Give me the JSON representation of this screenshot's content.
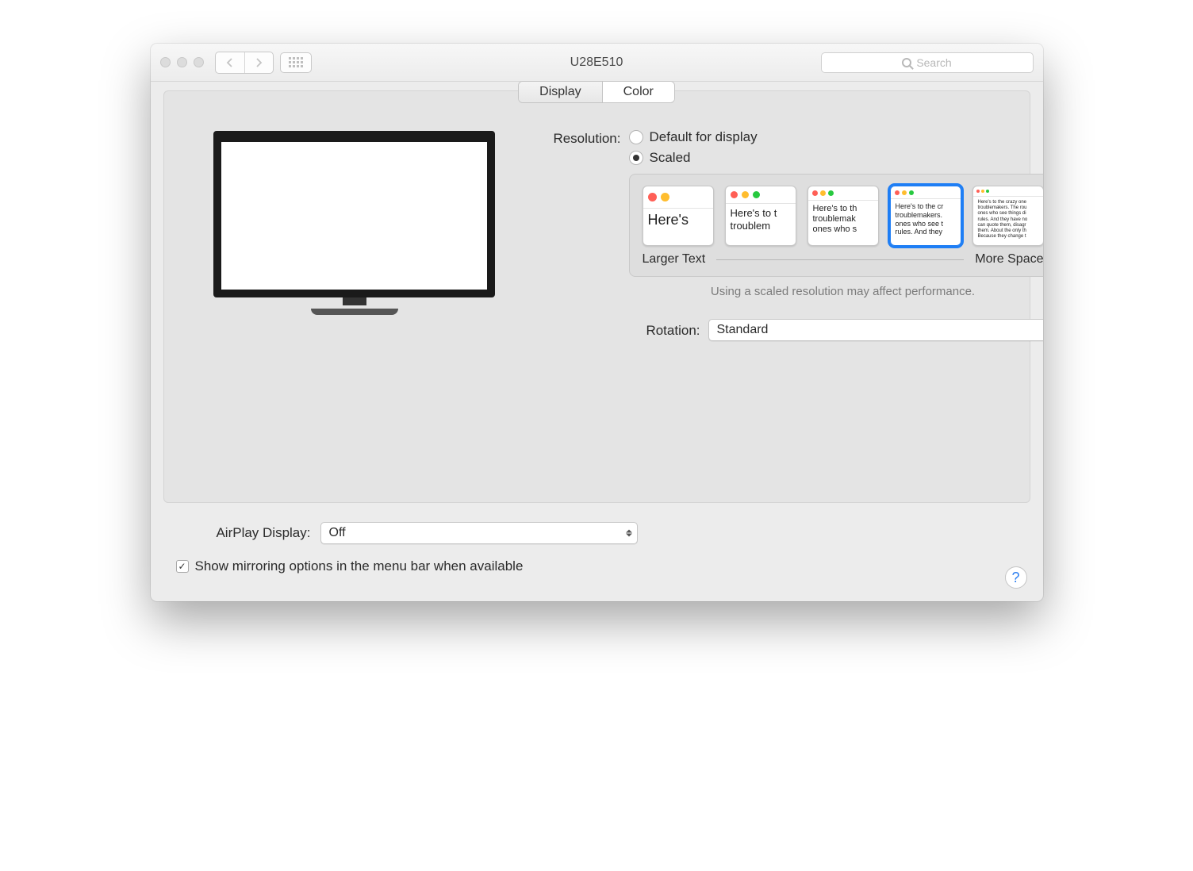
{
  "title": "U28E510",
  "search": {
    "placeholder": "Search"
  },
  "tabs": {
    "display": "Display",
    "color": "Color",
    "active": "display"
  },
  "resolution": {
    "label": "Resolution:",
    "options": {
      "default": "Default for display",
      "scaled": "Scaled"
    },
    "selected": "scaled"
  },
  "scale": {
    "larger": "Larger Text",
    "more": "More Space",
    "thumbs": [
      {
        "text": "Here's",
        "dots": 2,
        "size": "lg"
      },
      {
        "text": "Here's to t\ntroublem",
        "dots": 3,
        "size": "md"
      },
      {
        "text": "Here's to th\ntroublemak\nones who s",
        "dots": 3,
        "size": "sm"
      },
      {
        "text": "Here's to the cr\ntroublemakers.\nones who see t\nrules. And they",
        "dots": 3,
        "size": "xs",
        "selected": true
      },
      {
        "text": "Here's to the crazy one\ntroublemakers. The rou\nones who see things di\nrules. And they have no\ncan quote them, disagr\nthem. About the only th\nBecause they change t",
        "dots": 3,
        "size": "xxs"
      }
    ],
    "note": "Using a scaled resolution may affect performance."
  },
  "rotation": {
    "label": "Rotation:",
    "value": "Standard"
  },
  "airplay": {
    "label": "AirPlay Display:",
    "value": "Off"
  },
  "mirroring": {
    "checked": true,
    "label": "Show mirroring options in the menu bar when available"
  },
  "help": "?"
}
